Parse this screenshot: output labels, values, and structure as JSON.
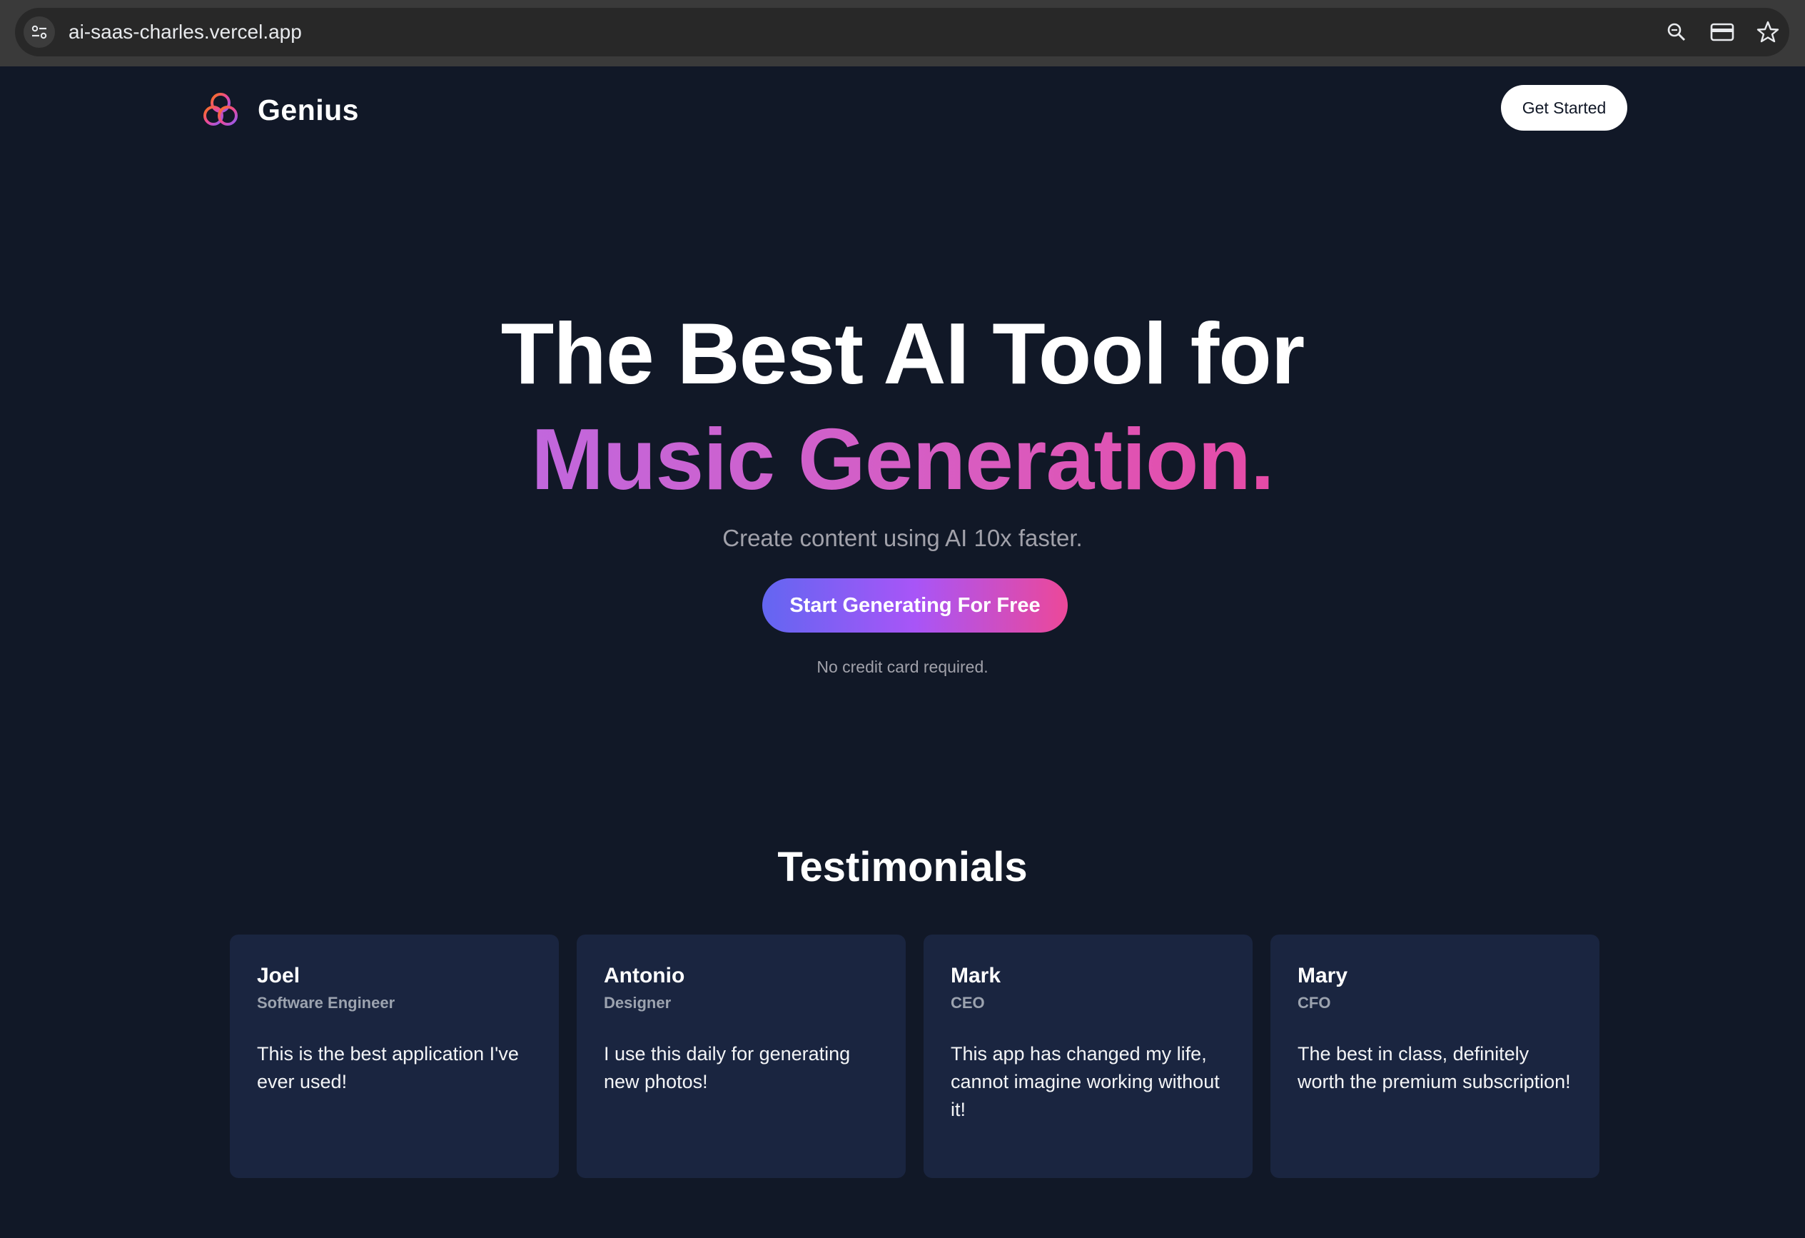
{
  "browser": {
    "url": "ai-saas-charles.vercel.app",
    "icons": [
      "site-settings-icon",
      "zoom-icon",
      "card-icon",
      "bookmark-star-icon"
    ]
  },
  "navbar": {
    "brand": "Genius",
    "cta": "Get Started"
  },
  "hero": {
    "line1": "The Best AI Tool for",
    "line2": "Music Generation.",
    "subtitle": "Create content using AI 10x faster.",
    "cta": "Start Generating For Free",
    "note": "No credit card required."
  },
  "testimonials": {
    "title": "Testimonials",
    "items": [
      {
        "name": "Joel",
        "role": "Software Engineer",
        "text": "This is the best application I've ever used!"
      },
      {
        "name": "Antonio",
        "role": "Designer",
        "text": "I use this daily for generating new photos!"
      },
      {
        "name": "Mark",
        "role": "CEO",
        "text": "This app has changed my life, cannot imagine working without it!"
      },
      {
        "name": "Mary",
        "role": "CFO",
        "text": "The best in class, definitely worth the premium subscription!"
      }
    ]
  },
  "colors": {
    "background": "#111827",
    "card": "#1a2540",
    "gradient_start": "#6366f1",
    "gradient_end": "#ec4899"
  }
}
